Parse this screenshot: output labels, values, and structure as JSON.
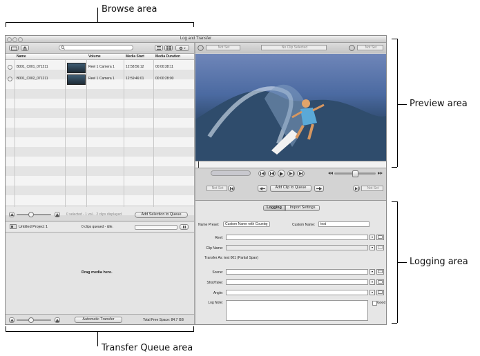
{
  "callouts": {
    "browse": "Browse area",
    "preview": "Preview area",
    "logging": "Logging area",
    "transfer": "Transfer Queue area"
  },
  "window": {
    "title": "Log and Transfer"
  },
  "browse": {
    "search_placeholder": "",
    "columns": [
      "Name",
      "",
      "Volume",
      "Media Start",
      "Media Duration"
    ],
    "rows": [
      {
        "name": "B001_C001_071211",
        "volume": "Reel 1 Camera 1",
        "start": "12:58:56:12",
        "duration": "00:00:38:11"
      },
      {
        "name": "B001_C002_071211",
        "volume": "Reel 1 Camera 1",
        "start": "12:59:46:01",
        "duration": "00:00:28:00"
      }
    ],
    "status": "0 selected - 1 vol... 2 clips displayed",
    "add_selection_label": "Add Selection to Queue"
  },
  "queue": {
    "project_name": "Untitled Project 1",
    "status": "0 clips queued - idle.",
    "drag_hint": "Drag media here.",
    "auto_transfer_label": "Automatic Transfer",
    "free_space": "Total Free Space: 84.7 GB"
  },
  "preview": {
    "in_label": "Not Set",
    "out_label": "Not Set",
    "clip_label": "No Clip Selected",
    "mark_in": "Not Set",
    "mark_out": "Not Set",
    "add_clip_label": "Add Clip to Queue"
  },
  "logging": {
    "tab_logging": "Logging",
    "tab_import": "Import Settings",
    "name_preset_label": "Name Preset:",
    "name_preset_value": "Custom Name with Counter",
    "custom_name_label": "Custom Name:",
    "custom_name_value": "test",
    "reel_label": "Reel:",
    "clip_name_label": "Clip Name:",
    "transfer_as": "Transfer As: test 001 (Partial Span)",
    "scene_label": "Scene:",
    "shot_label": "Shot/Take:",
    "angle_label": "Angle:",
    "log_note_label": "Log Note:",
    "good_label": "Good"
  }
}
